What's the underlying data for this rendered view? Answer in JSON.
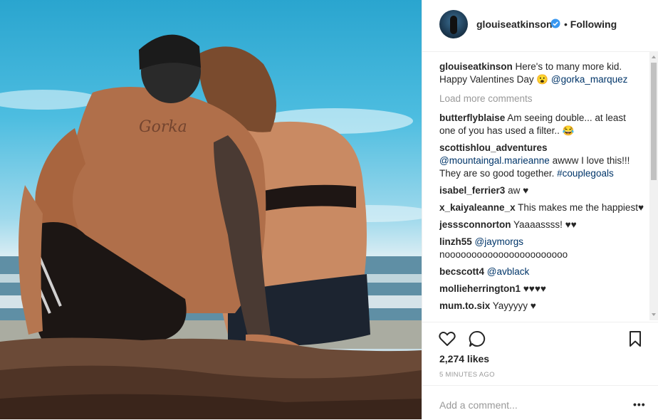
{
  "post": {
    "username": "glouiseatkinson",
    "follow_status": "Following",
    "photo_alt": "photo"
  },
  "comments": [
    {
      "user": "glouiseatkinson",
      "text": "Here's to many more kid. Happy Valentines Day 😮",
      "mention": "@gorka_marquez"
    }
  ],
  "load_more": "Load more comments",
  "thread": [
    {
      "user": "butterflyblaise",
      "text": "Am seeing double... at least one of you has used a filter.. 😂",
      "link": ""
    },
    {
      "user": "scottishlou_adventures",
      "text": "awww I love this!!! They are so good together.",
      "mention": "@mountaingal.marieanne",
      "tag": "#couplegoals"
    },
    {
      "user": "isabel_ferrier3",
      "text": "aw ♥",
      "link": ""
    },
    {
      "user": "x_kaiyaleanne_x",
      "text": "This makes me the happiest♥",
      "link": ""
    },
    {
      "user": "jesssconnorton",
      "text": "Yaaaassss! ♥♥",
      "link": ""
    },
    {
      "user": "linzh55",
      "text": "nooooooooooooooooooooooo",
      "mention": "@jaymorgs"
    },
    {
      "user": "becscott4",
      "text": "",
      "mention": "@avblack"
    },
    {
      "user": "mollieherrington1",
      "text": "♥♥♥♥",
      "link": ""
    },
    {
      "user": "mum.to.six",
      "text": "Yayyyyy ♥",
      "link": ""
    }
  ],
  "likes": "2,274 likes",
  "timestamp": "5 MINUTES AGO",
  "add_comment_placeholder": "Add a comment...",
  "more_options": "•••",
  "colors": {
    "verified": "#3897f0",
    "link": "#003569",
    "muted": "#999999"
  }
}
